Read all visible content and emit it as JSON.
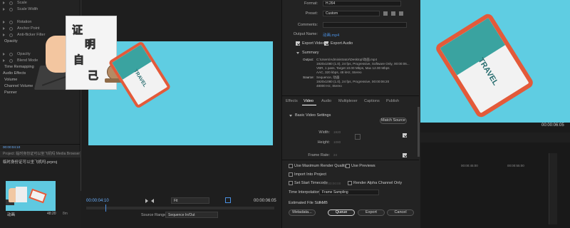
{
  "effect_controls": {
    "rows": [
      {
        "label": "Scale",
        "kind": "prop"
      },
      {
        "label": "Scale Width",
        "kind": "prop"
      },
      {
        "label": "",
        "kind": "blank"
      },
      {
        "label": "Rotation",
        "kind": "prop"
      },
      {
        "label": "Anchor Point",
        "kind": "prop"
      },
      {
        "label": "Anti-flicker Filter",
        "kind": "prop"
      },
      {
        "label": "Opacity",
        "kind": "section"
      },
      {
        "label": "",
        "kind": "blank"
      },
      {
        "label": "Opacity",
        "kind": "prop"
      },
      {
        "label": "Blend Mode",
        "kind": "prop"
      },
      {
        "label": "Time Remapping",
        "kind": "section"
      },
      {
        "label": "Audio Effects",
        "kind": "header"
      },
      {
        "label": "Volume",
        "kind": "section"
      },
      {
        "label": "Channel Volume",
        "kind": "section"
      },
      {
        "label": "Panner",
        "kind": "section"
      }
    ],
    "footer_timecode": "00:00:04:10"
  },
  "project": {
    "header": "Project: 临时身份证可以坐飞机吗  Media Browser  Libraries",
    "file": "临时身份证可以坐飞机吗.prproj",
    "item_name": "动画",
    "item_duration": "48:20",
    "item_badge": "8m"
  },
  "source_monitor": {
    "paper_chars": [
      "证",
      "明",
      "自",
      "己"
    ],
    "ticket_text": "TRAVEL",
    "timecode_current": "00:00:04:10",
    "timecode_end": "00:00:06:05",
    "fit_value": "Fit",
    "source_range_label": "Source Range:",
    "source_range_value": "Sequence In/Out"
  },
  "export": {
    "format_label": "Format:",
    "format_value": "H.264",
    "preset_label": "Preset:",
    "preset_value": "Custom",
    "comments_label": "Comments:",
    "comments_value": "",
    "output_name_label": "Output Name:",
    "output_name_value": "动画.mp4",
    "export_video_label": "Export Video",
    "export_audio_label": "Export Audio",
    "summary_label": "Summary",
    "output_label": "Output:",
    "output_lines": [
      "C:\\Users\\Administrator\\Desktop\\动画.mp4",
      "1920x1080 (1.0), 24 fps, Progressive, Software Only, 00:00:06...",
      "VBR, 1 pass, Target 10.00 Mbps, Max 12.00 Mbps",
      "AAC, 320 kbps, 48 kHz, Stereo"
    ],
    "source_label": "Source:",
    "source_lines": [
      "Sequence, 动画",
      "1920x1080 (1.0), 24 fps, Progressive, 00:00:06:20",
      "48000 Hz, Stereo"
    ],
    "tabs": [
      "Effects",
      "Video",
      "Audio",
      "Multiplexer",
      "Captions",
      "Publish"
    ],
    "active_tab": "Video",
    "basic_video_label": "Basic Video Settings",
    "match_source_label": "Match Source",
    "width_label": "Width:",
    "width_value": "1920",
    "height_label": "Height:",
    "height_value": "1080",
    "frame_rate_label": "Frame Rate:",
    "frame_rate_value": "24",
    "options": {
      "max_render_quality": "Use Maximum Render Quality",
      "use_previews": "Use Previews",
      "import_into_project": "Import Into Project",
      "set_start_timecode": "Set Start Timecode",
      "start_timecode_value": "00:00:00:00",
      "render_alpha": "Render Alpha Channel Only"
    },
    "time_interp_label": "Time Interpolation:",
    "time_interp_value": "Frame Sampling",
    "est_size_label": "Estimated File Size:",
    "est_size_value": "7 MB",
    "buttons": {
      "metadata": "Metadata...",
      "queue": "Queue",
      "export": "Export",
      "cancel": "Cancel"
    }
  },
  "program_monitor": {
    "ticket_text": "TRAVEL",
    "timecode": "00:00:06:05",
    "ruler_a": "00:00:45:00",
    "ruler_b": "00:00:55:00"
  },
  "colors": {
    "accent_blue": "#4a90e2",
    "preview_bg": "#5fcde2",
    "ticket_border": "#e35a3a",
    "ticket_stripe": "#3aa3a0"
  }
}
